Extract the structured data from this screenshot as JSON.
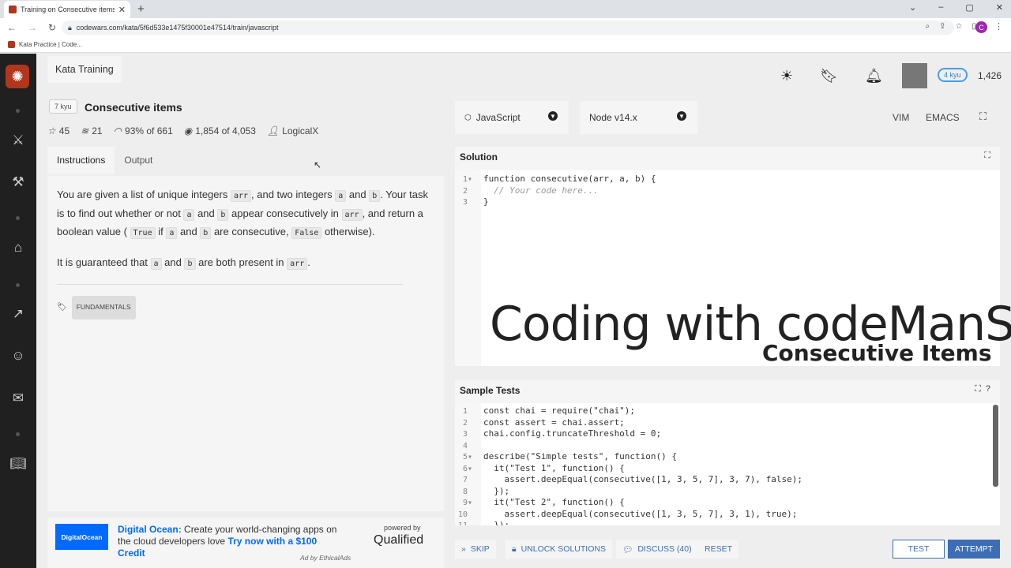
{
  "browser": {
    "tab_title": "Training on Consecutive items | C",
    "url": "codewars.com/kata/5f6d533e1475f30001e47514/train/javascript",
    "bookmark": "Kata Practice | Code...",
    "profile_initial": "C"
  },
  "header": {
    "kata_training_tab": "Kata Training",
    "rank": "4 kyu",
    "honor": "1,426"
  },
  "kata": {
    "kyu": "7 kyu",
    "title": "Consecutive items",
    "stars": "45",
    "collections": "21",
    "satisfaction": "93% of 661",
    "completed": "1,854 of 4,053",
    "author": "LogicalX"
  },
  "tabs": {
    "instructions": "Instructions",
    "output": "Output"
  },
  "description": {
    "p1_a": "You are given a list of unique integers ",
    "p1_code1": "arr",
    "p1_b": ", and two integers ",
    "p1_code2": "a",
    "p1_c": " and ",
    "p1_code3": "b",
    "p1_d": ". Your task is to find out whether or not ",
    "p1_code4": "a",
    "p1_e": " and ",
    "p1_code5": "b",
    "p1_f": " appear consecutively in ",
    "p1_code6": "arr",
    "p1_g": ", and return a boolean value ( ",
    "p1_code7": "True",
    "p1_h": " if ",
    "p1_code8": "a",
    "p1_i": " and ",
    "p1_code9": "b",
    "p1_j": " are consecutive, ",
    "p1_code10": "False",
    "p1_k": " otherwise).",
    "p2_a": "It is guaranteed that ",
    "p2_code1": "a",
    "p2_b": " and ",
    "p2_code2": "b",
    "p2_c": " are both present in ",
    "p2_code3": "arr",
    "p2_d": ".",
    "tag": "FUNDAMENTALS"
  },
  "ad": {
    "logo": "DigitalOcean",
    "brand": "Digital Ocean:",
    "text": " Create your world-changing apps on the cloud developers love ",
    "cta": "Try now with a $100 Credit",
    "powered": "powered by",
    "qualified": "Qualified",
    "ethical": "Ad by EthicalAds"
  },
  "editor": {
    "language": "JavaScript",
    "version": "Node v14.x",
    "vim": "VIM",
    "emacs": "EMACS",
    "solution_label": "Solution",
    "solution_lines": [
      "function consecutive(arr, a, b) {",
      "  // Your code here...",
      "}"
    ],
    "watermark": "Coding with codeManS",
    "watermark_sub": "Consecutive Items",
    "tests_label": "Sample Tests",
    "test_lines": [
      "const chai = require(\"chai\");",
      "const assert = chai.assert;",
      "chai.config.truncateThreshold = 0;",
      "",
      "describe(\"Simple tests\", function() {",
      "  it(\"Test 1\", function() {",
      "    assert.deepEqual(consecutive([1, 3, 5, 7], 3, 7), false);",
      "  });",
      "  it(\"Test 2\", function() {",
      "    assert.deepEqual(consecutive([1, 3, 5, 7], 3, 1), true);",
      "  });"
    ]
  },
  "actions": {
    "skip": "SKIP",
    "unlock": "UNLOCK SOLUTIONS",
    "discuss": "DISCUSS (40)",
    "reset": "RESET",
    "test": "TEST",
    "attempt": "ATTEMPT"
  },
  "colors": {
    "accent": "#3d6db5",
    "brand": "#b1361e"
  }
}
